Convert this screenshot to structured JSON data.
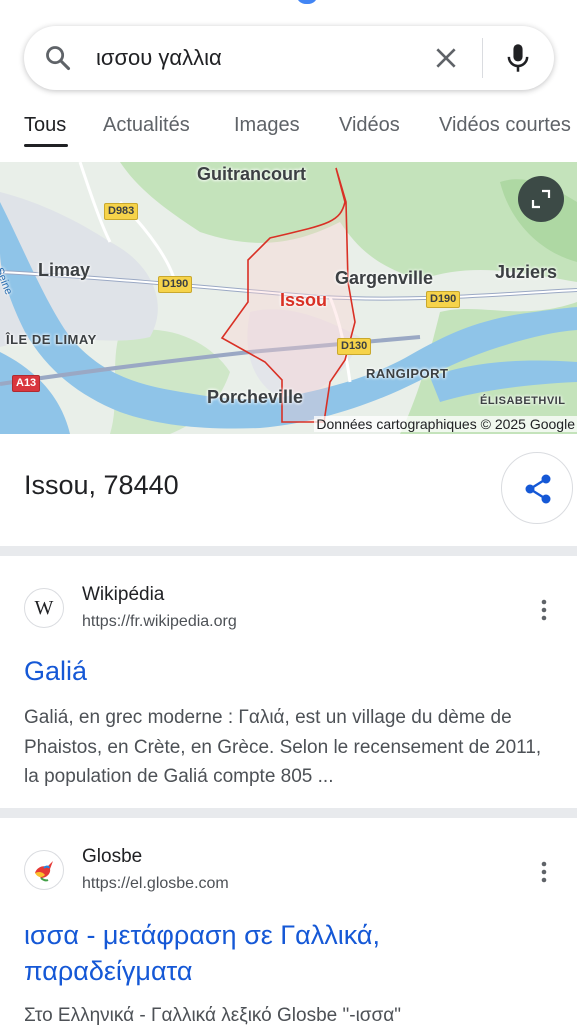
{
  "search": {
    "query": "ισσου γαλλια"
  },
  "tabs": [
    {
      "label": "Tous",
      "active": true
    },
    {
      "label": "Actualités"
    },
    {
      "label": "Images"
    },
    {
      "label": "Vidéos"
    },
    {
      "label": "Vidéos courtes"
    }
  ],
  "map": {
    "labels": {
      "guitrancourt": "Guitrancourt",
      "limay": "Limay",
      "seine": "Seine",
      "ile_de_limay": "ÎLE DE LIMAY",
      "issou": "Issou",
      "gargenville": "Gargenville",
      "juziers": "Juziers",
      "rangiport": "RANGIPORT",
      "porcheville": "Porcheville",
      "elisabethville": "ÉLISABETHVIL"
    },
    "roads": {
      "d983": "D983",
      "d190_left": "D190",
      "d190_right": "D190",
      "d130": "D130",
      "a13": "A13"
    },
    "copyright": "Données cartographiques © 2025 Google",
    "expand_icon": "expand-icon"
  },
  "place": {
    "title": "Issou, 78440",
    "share_icon": "share-icon"
  },
  "results": [
    {
      "site_name": "Wikipédia",
      "url": "https://fr.wikipedia.org",
      "favicon": "W",
      "title": "Galiá",
      "snippet": "Galiá, en grec moderne : Γαλιά, est un village du dème de Phaistos, en Crète, en Grèce. Selon le recensement de 2011, la population de Galiá compte 805 ..."
    },
    {
      "site_name": "Glosbe",
      "url": "https://el.glosbe.com",
      "favicon": "hummingbird",
      "title": "ισσα - μετάφραση σε Γαλλικά, παραδείγματα",
      "snippet": "Στο Ελληνικά - Γαλλικά λεξικό Glosbe \"-ισσα\""
    }
  ],
  "colors": {
    "link": "#1558d6",
    "water": "#8fc4e8",
    "park": "#b9dfb0",
    "boundary": "#d93025"
  }
}
